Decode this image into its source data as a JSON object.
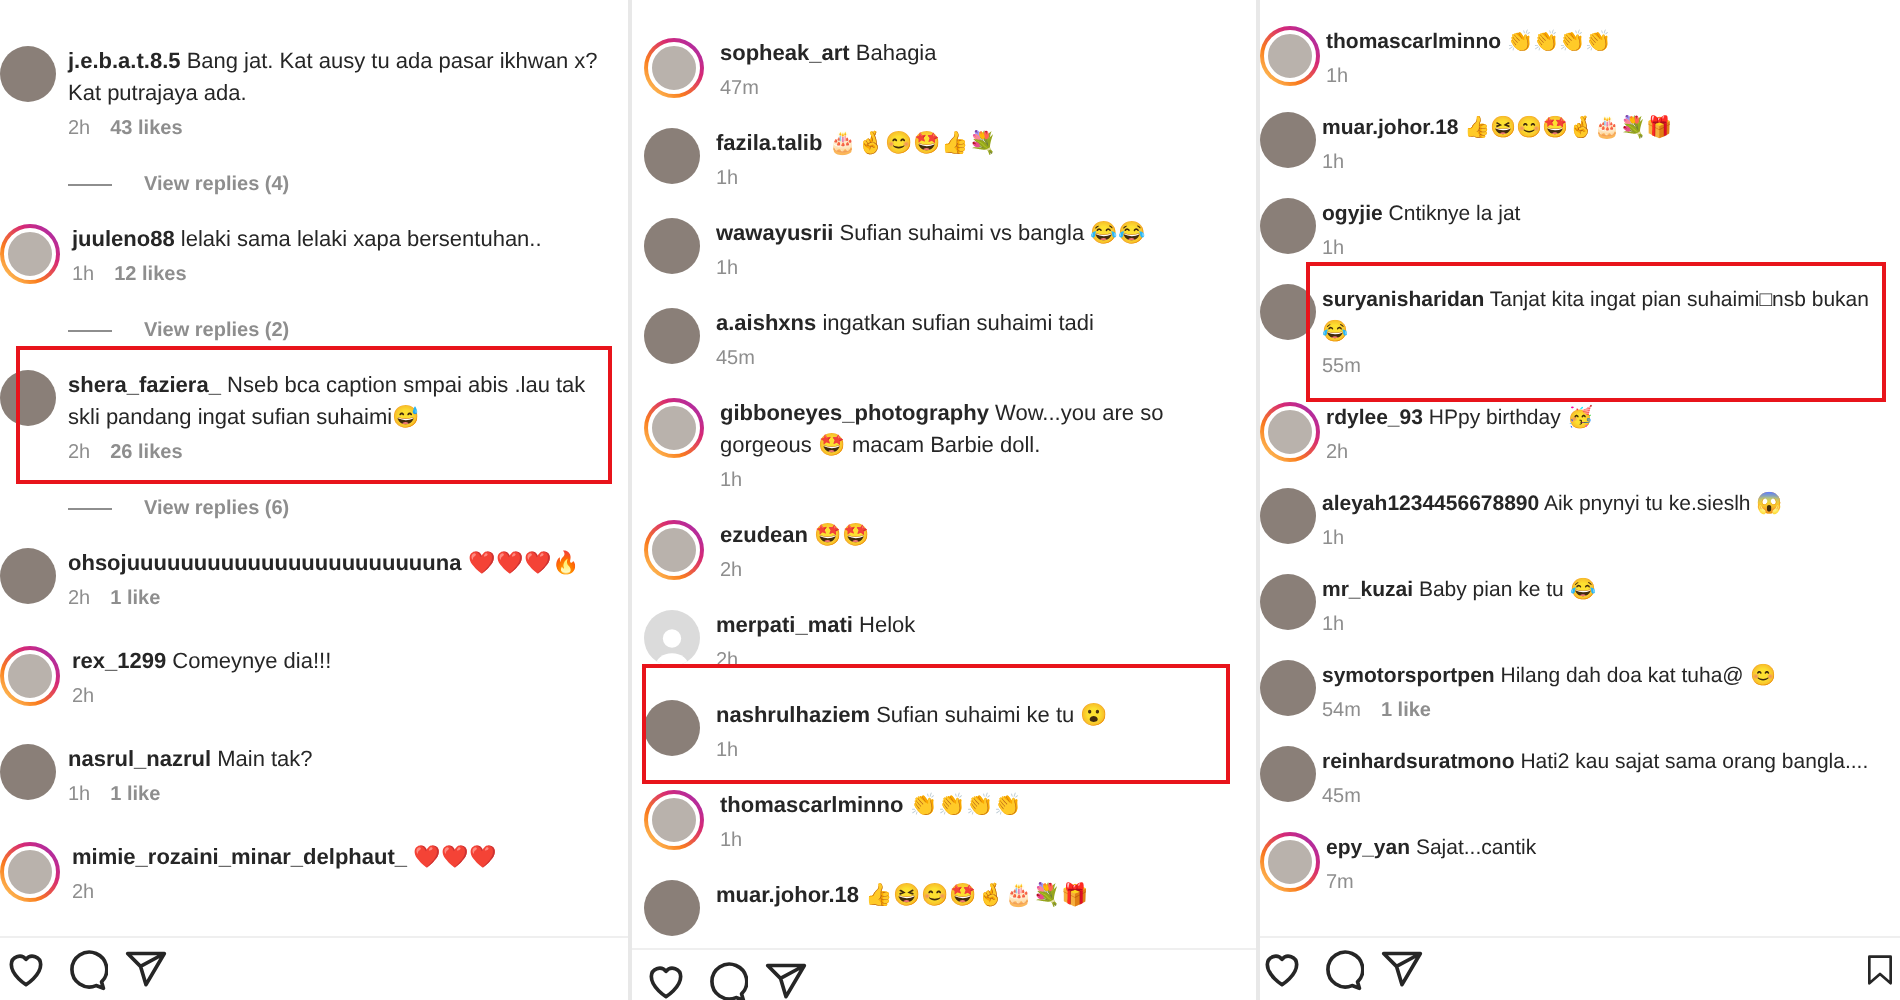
{
  "panels": [
    {
      "show_bookmark": false,
      "items": [
        {
          "kind": "comment",
          "username": "j.e.b.a.t.8.5",
          "text": "Bang jat. Kat ausy tu ada pasar ikhwan x? Kat putrajaya ada.",
          "time": "2h",
          "likes": "43 likes",
          "story_ring": false,
          "highlighted": false
        },
        {
          "kind": "view_replies",
          "label": "View replies (4)"
        },
        {
          "kind": "comment",
          "username": "juuleno88",
          "text": "lelaki sama lelaki xapa bersentuhan..",
          "time": "1h",
          "likes": "12 likes",
          "story_ring": true,
          "highlighted": false
        },
        {
          "kind": "view_replies",
          "label": "View replies (2)"
        },
        {
          "kind": "comment",
          "username": "shera_faziera_",
          "text": "Nseb bca caption smpai abis .lau tak skli pandang ingat sufian suhaimi😅",
          "time": "2h",
          "likes": "26 likes",
          "story_ring": false,
          "highlighted": true
        },
        {
          "kind": "view_replies",
          "label": "View replies (6)"
        },
        {
          "kind": "comment",
          "username": "ohsojuuuuuuuuuuuuuuuuuuuuuuuna",
          "text": "❤️❤️❤️🔥",
          "time": "2h",
          "likes": "1 like",
          "story_ring": false,
          "highlighted": false
        },
        {
          "kind": "comment",
          "username": "rex_1299",
          "text": "Comeynye dia!!!",
          "time": "2h",
          "story_ring": true,
          "highlighted": false
        },
        {
          "kind": "comment",
          "username": "nasrul_nazrul",
          "text": "Main tak?",
          "time": "1h",
          "likes": "1 like",
          "story_ring": false,
          "highlighted": false
        },
        {
          "kind": "comment",
          "username": "mimie_rozaini_minar_delphaut_",
          "text": "❤️❤️❤️",
          "time": "2h",
          "story_ring": true,
          "highlighted": false
        }
      ]
    },
    {
      "show_bookmark": false,
      "items": [
        {
          "kind": "comment",
          "username": "sopheak_art",
          "text": "Bahagia",
          "time": "47m",
          "story_ring": true,
          "highlighted": false
        },
        {
          "kind": "comment",
          "username": "fazila.talib",
          "text": "🎂🤞😊🤩👍💐",
          "time": "1h",
          "story_ring": false,
          "highlighted": false
        },
        {
          "kind": "comment",
          "username": "wawayusrii",
          "text": "Sufian suhaimi vs bangla 😂😂",
          "time": "1h",
          "story_ring": false,
          "highlighted": false
        },
        {
          "kind": "comment",
          "username": "a.aishxns",
          "text": "ingatkan sufian suhaimi tadi",
          "time": "45m",
          "story_ring": false,
          "highlighted": false
        },
        {
          "kind": "comment",
          "username": "gibboneyes_photography",
          "text": "Wow...you are so gorgeous 🤩 macam Barbie doll.",
          "time": "1h",
          "story_ring": true,
          "highlighted": false
        },
        {
          "kind": "comment",
          "username": "ezudean",
          "text": "🤩🤩",
          "time": "2h",
          "story_ring": true,
          "highlighted": false
        },
        {
          "kind": "comment",
          "username": "merpati_mati",
          "text": "Helok",
          "time": "2h",
          "story_ring": false,
          "default_avatar": true,
          "highlighted": false
        },
        {
          "kind": "comment",
          "username": "nashrulhaziem",
          "text": "Sufian suhaimi ke tu 😮",
          "time": "1h",
          "story_ring": false,
          "highlighted": true
        },
        {
          "kind": "comment",
          "username": "thomascarlminno",
          "text": "👏👏👏👏",
          "time": "1h",
          "story_ring": true,
          "highlighted": false
        },
        {
          "kind": "comment",
          "username": "muar.johor.18",
          "text": "👍😆😊🤩🤞🎂💐🎁",
          "story_ring": false,
          "highlighted": false
        }
      ]
    },
    {
      "show_bookmark": true,
      "items": [
        {
          "kind": "comment",
          "username": "thomascarlminno",
          "text": "👏👏👏👏",
          "time": "1h",
          "story_ring": true,
          "highlighted": false
        },
        {
          "kind": "comment",
          "username": "muar.johor.18",
          "text": "👍😆😊🤩🤞🎂💐🎁",
          "time": "1h",
          "story_ring": false,
          "highlighted": false
        },
        {
          "kind": "comment",
          "username": "ogyjie",
          "text": "Cntiknye la jat",
          "time": "1h",
          "story_ring": false,
          "highlighted": false
        },
        {
          "kind": "comment",
          "username": "suryanisharidan",
          "text": "Tanjat kita ingat pian suhaimi□nsb bukan😂",
          "time": "55m",
          "story_ring": false,
          "highlighted": true
        },
        {
          "kind": "comment",
          "username": "rdylee_93",
          "text": "HPpy birthday 🥳",
          "time": "2h",
          "story_ring": true,
          "highlighted": false
        },
        {
          "kind": "comment",
          "username": "aleyah1234456678890",
          "text": "Aik pnynyi tu ke.sieslh 😱",
          "time": "1h",
          "story_ring": false,
          "highlighted": false
        },
        {
          "kind": "comment",
          "username": "mr_kuzai",
          "text": "Baby pian ke tu 😂",
          "time": "1h",
          "story_ring": false,
          "highlighted": false
        },
        {
          "kind": "comment",
          "username": "symotorsportpen",
          "text": "Hilang dah doa kat tuha@ 😊",
          "time": "54m",
          "likes": "1 like",
          "story_ring": false,
          "highlighted": false
        },
        {
          "kind": "comment",
          "username": "reinhardsuratmono",
          "text": "Hati2 kau sajat sama orang bangla....",
          "time": "45m",
          "story_ring": false,
          "highlighted": false
        },
        {
          "kind": "comment",
          "username": "epy_yan",
          "text": "Sajat...cantik",
          "time": "7m",
          "story_ring": true,
          "highlighted": false
        }
      ]
    }
  ]
}
